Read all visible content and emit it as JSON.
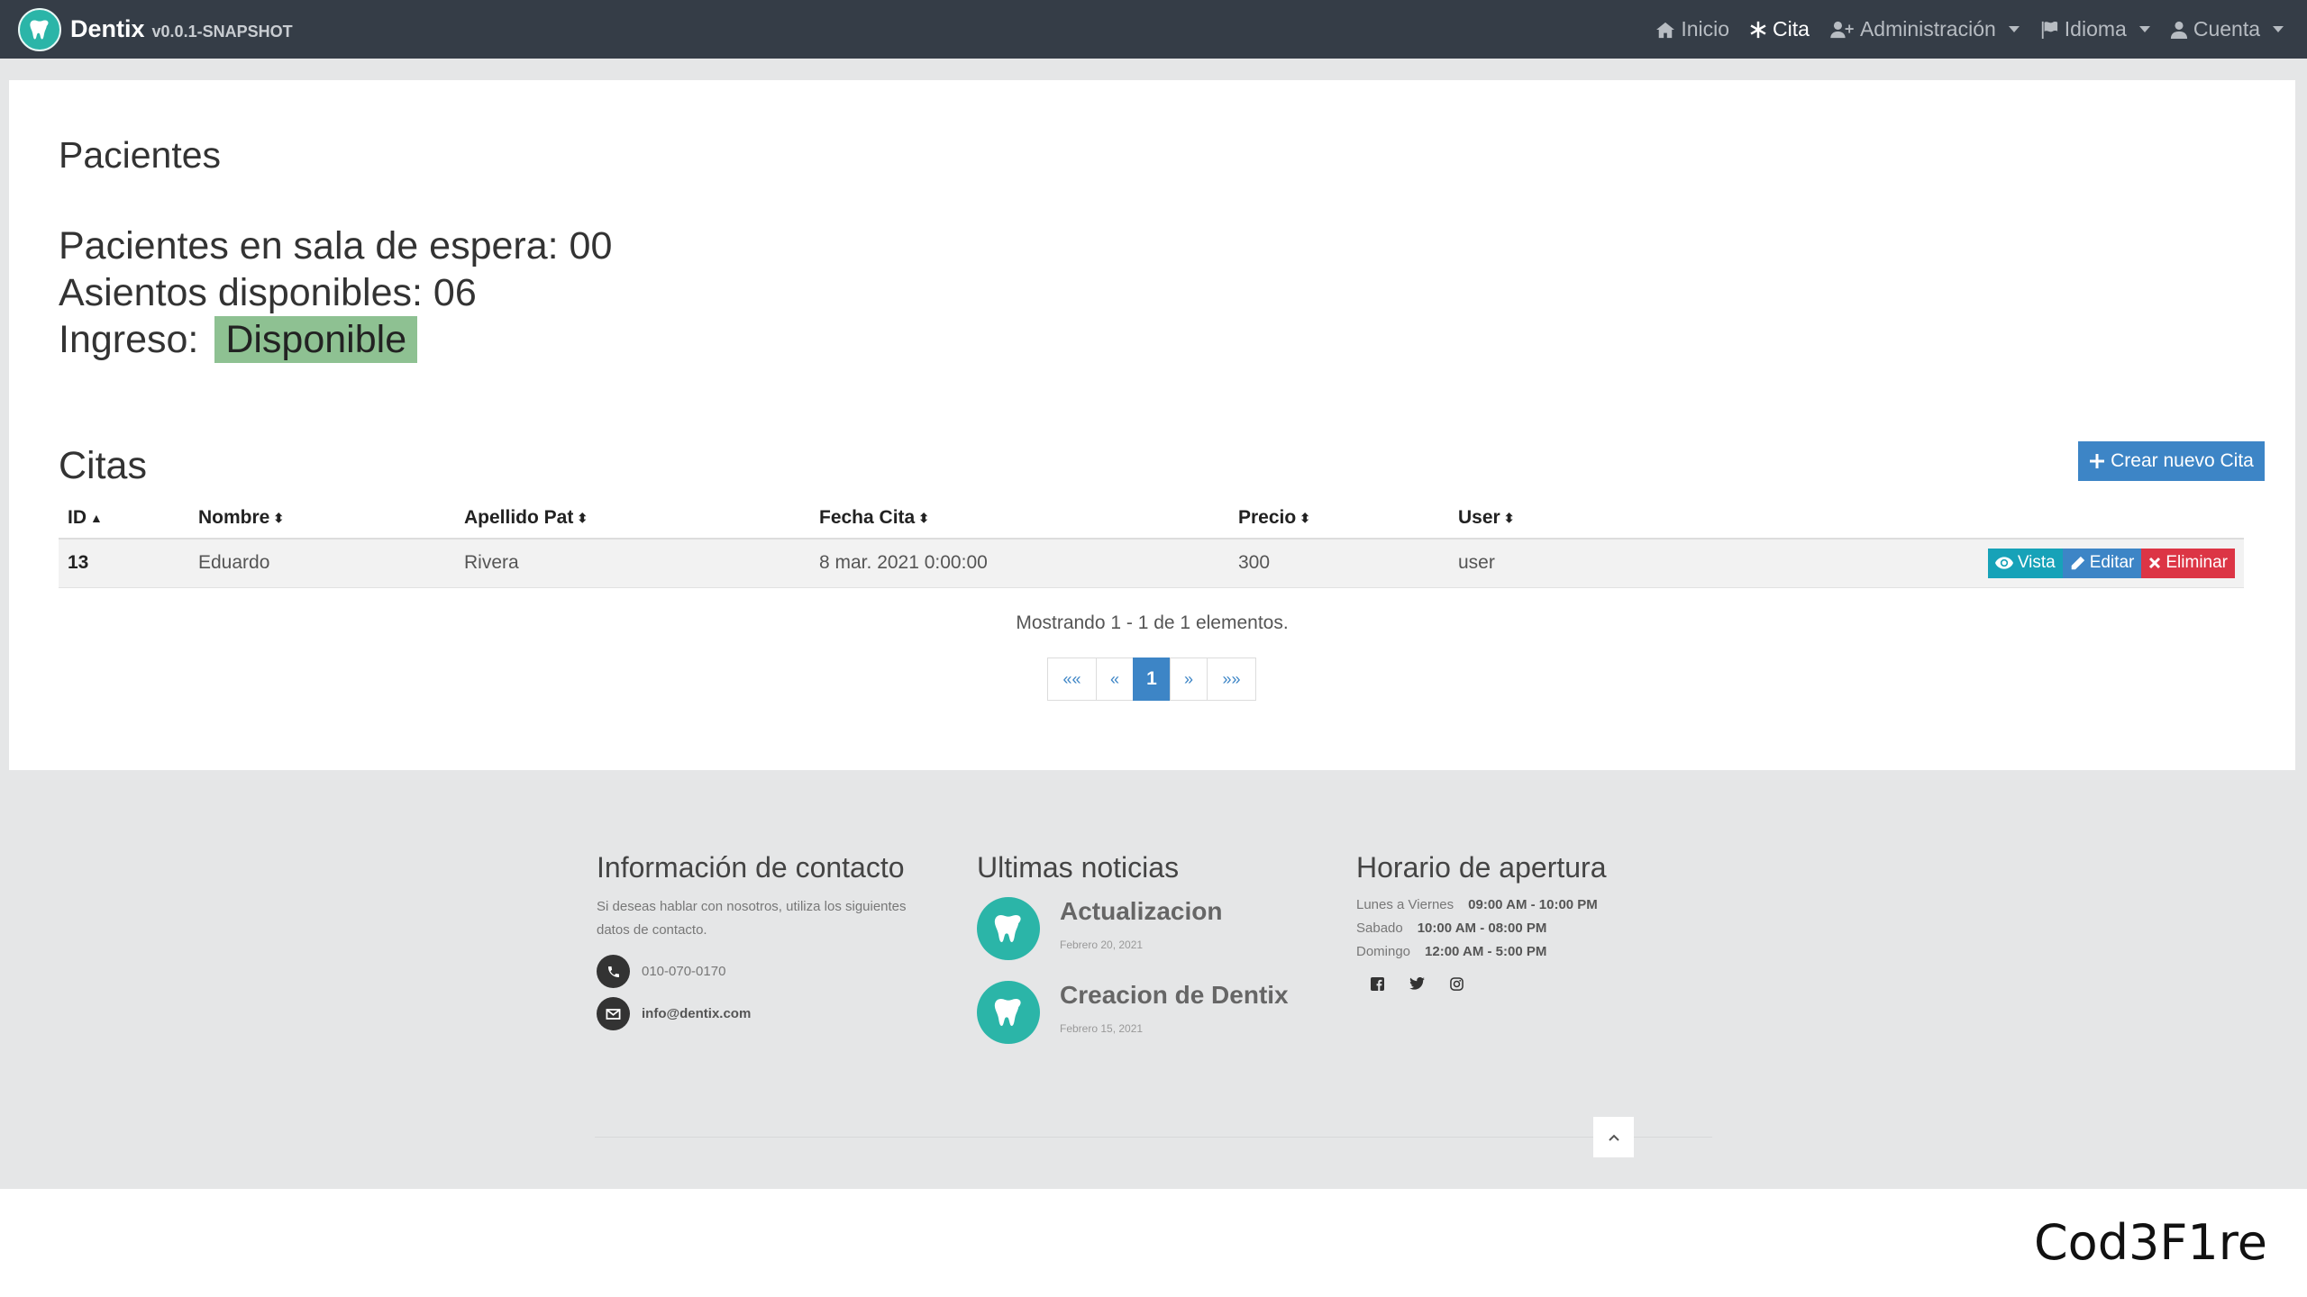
{
  "navbar": {
    "brand_name": "Dentix",
    "version": "v0.0.1-SNAPSHOT",
    "items": [
      {
        "label": "Inicio",
        "icon": "home-icon"
      },
      {
        "label": "Cita",
        "icon": "asterisk-icon"
      },
      {
        "label": "Administración",
        "icon": "user-plus-icon"
      },
      {
        "label": "Idioma",
        "icon": "flag-icon"
      },
      {
        "label": "Cuenta",
        "icon": "user-icon"
      }
    ]
  },
  "pacientes": {
    "title": "Pacientes",
    "waiting_label": "Pacientes en sala de espera:",
    "waiting_value": "00",
    "seats_label": "Asientos disponibles:",
    "seats_value": "06",
    "entry_label": "Ingreso:",
    "entry_status": "Disponible"
  },
  "citas": {
    "title": "Citas",
    "create_label": "Crear nuevo Cita",
    "columns": [
      "ID",
      "Nombre",
      "Apellido Pat",
      "Fecha Cita",
      "Precio",
      "User"
    ],
    "rows": [
      {
        "id": "13",
        "nombre": "Eduardo",
        "apellido": "Rivera",
        "fecha": "8 mar. 2021 0:00:00",
        "precio": "300",
        "user": "user"
      }
    ],
    "actions": {
      "view": "Vista",
      "edit": "Editar",
      "delete": "Eliminar"
    },
    "showing": "Mostrando 1 - 1 de 1 elementos.",
    "pagination": {
      "first": "««",
      "prev": "«",
      "current": "1",
      "next": "»",
      "last": "»»"
    }
  },
  "footer": {
    "contact": {
      "heading": "Información de contacto",
      "text": "Si deseas hablar con nosotros, utiliza los siguientes datos de contacto.",
      "phone": "010-070-0170",
      "email": "info@dentix.com"
    },
    "news": {
      "heading": "Ultimas noticias",
      "items": [
        {
          "title": "Actualizacion",
          "date": "Febrero 20, 2021"
        },
        {
          "title": "Creacion de Dentix",
          "date": "Febrero 15, 2021"
        }
      ]
    },
    "hours": {
      "heading": "Horario de apertura",
      "rows": [
        {
          "day": "Lunes a Viernes",
          "time": "09:00 AM - 10:00 PM"
        },
        {
          "day": "Sabado",
          "time": "10:00 AM - 08:00 PM"
        },
        {
          "day": "Domingo",
          "time": "12:00 AM - 5:00 PM"
        }
      ]
    }
  },
  "watermark": "Cod3F1re",
  "colors": {
    "navbar": "#353d47",
    "accent": "#3d85c6",
    "teal": "#2bb5a8",
    "available": "#8ec192",
    "danger": "#dc3545",
    "info": "#17a2b8"
  }
}
